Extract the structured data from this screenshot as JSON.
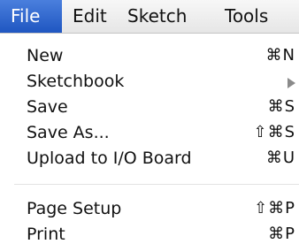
{
  "menubar": {
    "items": [
      {
        "label": "File",
        "active": true
      },
      {
        "label": "Edit",
        "active": false
      },
      {
        "label": "Sketch",
        "active": false
      },
      {
        "label": "Tools",
        "active": false
      }
    ]
  },
  "file_menu": {
    "items": [
      {
        "label": "New",
        "shortcut": "⌘N"
      },
      {
        "label": "Sketchbook",
        "shortcut": "",
        "submenu_icon": "submenu-arrow-icon"
      },
      {
        "label": "Save",
        "shortcut": "⌘S"
      },
      {
        "label": "Save As...",
        "shortcut": "⇧⌘S"
      },
      {
        "label": "Upload to I/O Board",
        "shortcut": "⌘U"
      },
      {
        "label": "Page Setup",
        "shortcut": "⇧⌘P"
      },
      {
        "label": "Print",
        "shortcut": "⌘P"
      }
    ]
  },
  "colors": {
    "highlight": "#2d63c8",
    "menubar_bg": "#ececec",
    "menu_bg": "#ffffff",
    "text": "#111111"
  }
}
